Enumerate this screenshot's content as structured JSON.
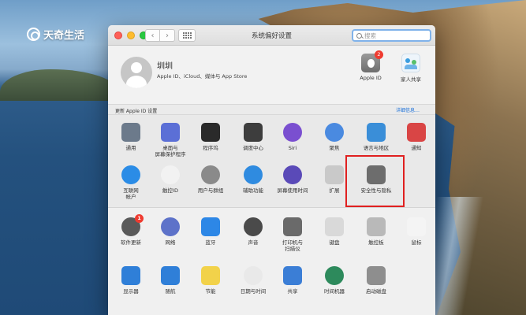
{
  "watermark": {
    "text": "天奇生活"
  },
  "window": {
    "title": "系统偏好设置",
    "search_placeholder": "搜索",
    "nav_back": "‹",
    "nav_forward": "›"
  },
  "account": {
    "name": "圳圳",
    "subtitle": "Apple ID、iCloud、媒体与 App Store",
    "apple_id_label": "Apple ID",
    "apple_id_badge": "2",
    "family_label": "家人共享"
  },
  "notice": {
    "text": "更新 Apple ID 设置",
    "link": "详细信息…"
  },
  "panes_row1": [
    {
      "label": "通用",
      "icon": "general-icon",
      "color": "#6c7a8b"
    },
    {
      "label": "桌面与\n屏幕保护程序",
      "icon": "desktop-icon",
      "color": "#5b6fd6"
    },
    {
      "label": "程序坞",
      "icon": "dock-icon",
      "color": "#2a2a2a"
    },
    {
      "label": "调度中心",
      "icon": "mission-control-icon",
      "color": "#3d3d3d"
    },
    {
      "label": "Siri",
      "icon": "siri-icon",
      "color": "#7a4fd0"
    },
    {
      "label": "聚焦",
      "icon": "spotlight-icon",
      "color": "#4a8ae0"
    },
    {
      "label": "语言与地区",
      "icon": "language-icon",
      "color": "#3a8ed8"
    },
    {
      "label": "通知",
      "icon": "notifications-icon",
      "color": "#d94545"
    }
  ],
  "panes_row2": [
    {
      "label": "互联网\n帐户",
      "icon": "internet-accounts-icon",
      "color": "#2b8ce6"
    },
    {
      "label": "触控ID",
      "icon": "touch-id-icon",
      "color": "#f2f2f2"
    },
    {
      "label": "用户与群组",
      "icon": "users-groups-icon",
      "color": "#8a8a8a"
    },
    {
      "label": "辅助功能",
      "icon": "accessibility-icon",
      "color": "#2f8be0"
    },
    {
      "label": "屏幕使用时间",
      "icon": "screen-time-icon",
      "color": "#5a4ab8"
    },
    {
      "label": "扩展",
      "icon": "extensions-icon",
      "color": "#c9c9c9"
    },
    {
      "label": "安全性与隐私",
      "icon": "security-privacy-icon",
      "color": "#6d6d6d"
    }
  ],
  "panes_row3": [
    {
      "label": "软件更新",
      "icon": "software-update-icon",
      "color": "#5a5a5a",
      "badge": "1"
    },
    {
      "label": "网络",
      "icon": "network-icon",
      "color": "#5d72c9"
    },
    {
      "label": "蓝牙",
      "icon": "bluetooth-icon",
      "color": "#2d87e6"
    },
    {
      "label": "声音",
      "icon": "sound-icon",
      "color": "#4a4a4a"
    },
    {
      "label": "打印机与\n扫描仪",
      "icon": "printers-icon",
      "color": "#6a6a6a"
    },
    {
      "label": "键盘",
      "icon": "keyboard-icon",
      "color": "#d9d9d9"
    },
    {
      "label": "触控板",
      "icon": "trackpad-icon",
      "color": "#b9b9b9"
    },
    {
      "label": "鼠标",
      "icon": "mouse-icon",
      "color": "#f4f4f4"
    }
  ],
  "panes_row4": [
    {
      "label": "显示器",
      "icon": "displays-icon",
      "color": "#2f7fd8"
    },
    {
      "label": "随航",
      "icon": "sidecar-icon",
      "color": "#2f7fd8"
    },
    {
      "label": "节能",
      "icon": "energy-saver-icon",
      "color": "#f2d24a"
    },
    {
      "label": "日期与时间",
      "icon": "date-time-icon",
      "color": "#e9e9e9"
    },
    {
      "label": "共享",
      "icon": "sharing-icon",
      "color": "#3b7ed6"
    },
    {
      "label": "时间机器",
      "icon": "time-machine-icon",
      "color": "#2d8a5c"
    },
    {
      "label": "启动磁盘",
      "icon": "startup-disk-icon",
      "color": "#8e8e8e"
    }
  ]
}
